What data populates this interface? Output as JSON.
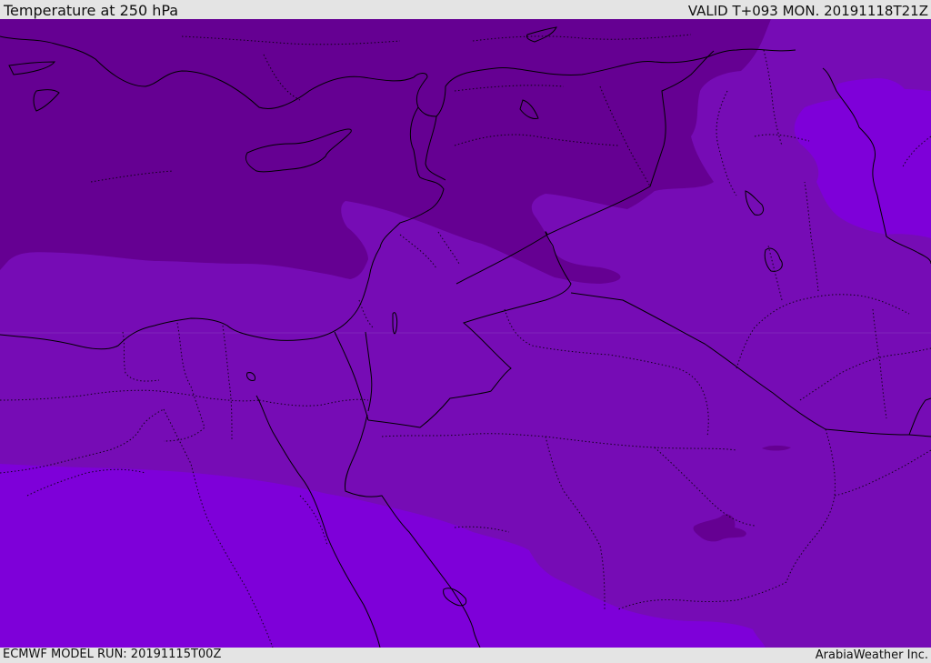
{
  "header": {
    "title": "Temperature at 250 hPa",
    "valid": "VALID T+093 MON. 20191118T21Z"
  },
  "footer": {
    "model_run": "ECMWF MODEL RUN: 20191115T00Z",
    "credit": "ArabiaWeather Inc."
  },
  "colors": {
    "coldest_band": "#650092",
    "cold_band": "#760cb5",
    "warm_band": "#7e00d9",
    "coastline": "#000000",
    "border": "#000000"
  }
}
